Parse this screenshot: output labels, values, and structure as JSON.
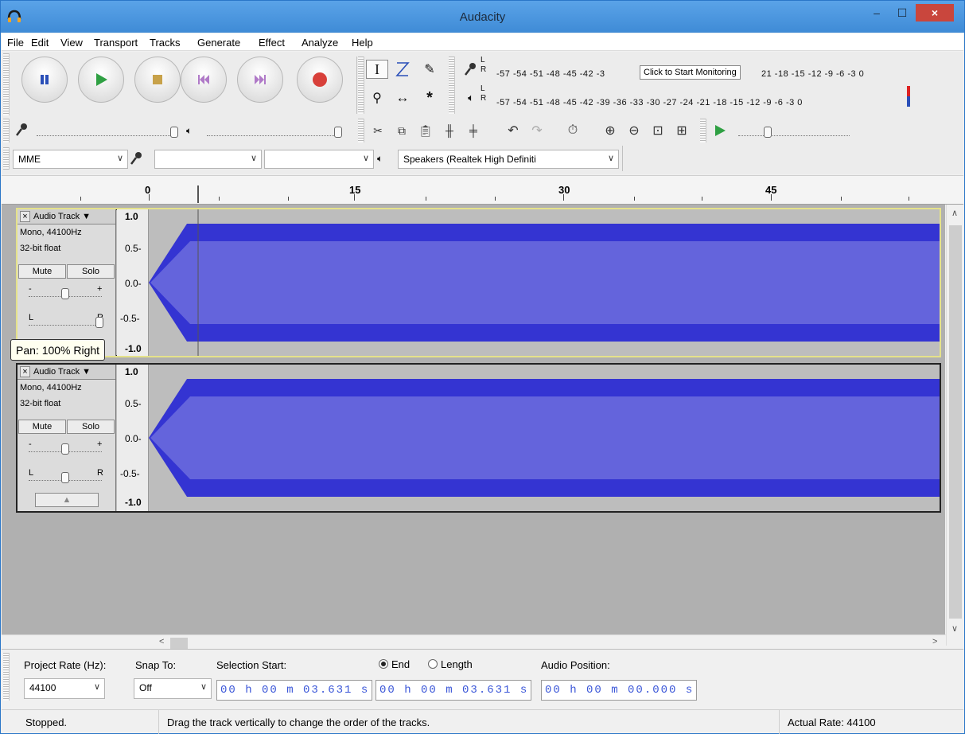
{
  "window": {
    "title": "Audacity",
    "minimize": "–",
    "maximize": "☐",
    "close": "×"
  },
  "menu": [
    "File",
    "Edit",
    "View",
    "Transport",
    "Tracks",
    "Generate",
    "Effect",
    "Analyze",
    "Help"
  ],
  "meters": {
    "record_scale": "-57 -54 -51 -48 -45 -42 -3",
    "record_scale_right": "21 -18 -15 -12  -9   -6   -3   0",
    "record_tip": "Click to Start Monitoring",
    "play_scale": "-57 -54 -51 -48 -45 -42 -39 -36 -33 -30 -27 -24 -21 -18 -15 -12  -9   -6   -3   0",
    "lr_top": "L",
    "lr_bottom": "R"
  },
  "device": {
    "host": "MME",
    "output": "Speakers (Realtek High Definiti"
  },
  "ruler": {
    "labels": [
      "0",
      "15",
      "30",
      "45"
    ]
  },
  "tracks": [
    {
      "name": "Audio Track ▼",
      "info1": "Mono, 44100Hz",
      "info2": "32-bit float",
      "mute": "Mute",
      "solo": "Solo",
      "gain_minus": "-",
      "gain_plus": "+",
      "pan_l": "L",
      "pan_r": "R",
      "scale": [
        "1.0",
        "0.5-",
        "0.0-",
        "-0.5-",
        "-1.0"
      ],
      "close": "×"
    },
    {
      "name": "Audio Track ▼",
      "info1": "Mono, 44100Hz",
      "info2": "32-bit float",
      "mute": "Mute",
      "solo": "Solo",
      "gain_minus": "-",
      "gain_plus": "+",
      "pan_l": "L",
      "pan_r": "R",
      "scale": [
        "1.0",
        "0.5-",
        "0.0-",
        "-0.5-",
        "-1.0"
      ],
      "close": "×",
      "collapse": "▲"
    }
  ],
  "pan_tooltip": "Pan: 100% Right",
  "selection": {
    "project_rate_label": "Project Rate (Hz):",
    "project_rate_value": "44100",
    "snap_label": "Snap To:",
    "snap_value": "Off",
    "start_label": "Selection Start:",
    "end_label": "End",
    "length_label": "Length",
    "audio_pos_label": "Audio Position:",
    "start_value": "00 h 00 m 03.631 s",
    "end_value": "00 h 00 m 03.631 s",
    "audio_pos_value": "00 h 00 m 00.000 s"
  },
  "status": {
    "state": "Stopped.",
    "hint": "Drag the track vertically to change the order of the tracks.",
    "rate": "Actual Rate: 44100"
  },
  "colors": {
    "wave_dark": "#3434d2",
    "wave_light": "#6464dc",
    "track_bg": "#bdbdbd",
    "focus": "#e5e28a"
  }
}
